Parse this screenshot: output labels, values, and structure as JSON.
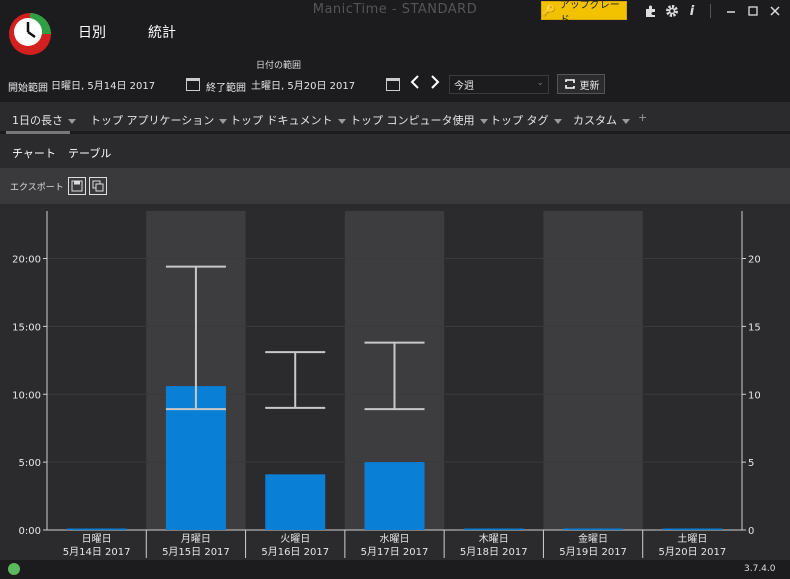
{
  "window": {
    "title": "ManicTime - STANDARD",
    "upgrade_label": "アップグレード"
  },
  "nav": {
    "tabs": [
      {
        "label": "日別"
      },
      {
        "label": "統計"
      }
    ]
  },
  "date_range": {
    "caption": "日付の範囲",
    "start_label": "開始範囲",
    "start_value": "日曜日, 5月14日 2017",
    "end_label": "終了範囲",
    "end_value": "土曜日, 5月20日 2017",
    "period_value": "今週",
    "refresh_label": "更新"
  },
  "report_tabs": [
    {
      "label": "1日の長さ"
    },
    {
      "label": "トップ アプリケーション"
    },
    {
      "label": "トップ ドキュメント"
    },
    {
      "label": "トップ コンピュータ使用"
    },
    {
      "label": "トップ タグ"
    },
    {
      "label": "カスタム"
    }
  ],
  "add_tab_label": "+",
  "view_tabs": [
    {
      "label": "チャート"
    },
    {
      "label": "テーブル"
    }
  ],
  "export": {
    "label": "エクスポート"
  },
  "status": {
    "version": "3.7.4.0"
  },
  "colors": {
    "bar": "#0a7fd6",
    "band": "#3d3d40",
    "bg": "#2b2b2d",
    "error_bar": "#c8c8c8",
    "status_ok": "#5cb85c"
  },
  "chart_data": {
    "type": "bar",
    "categories": [
      {
        "day": "日曜日",
        "date": "5月14日 2017"
      },
      {
        "day": "月曜日",
        "date": "5月15日 2017"
      },
      {
        "day": "火曜日",
        "date": "5月16日 2017"
      },
      {
        "day": "水曜日",
        "date": "5月17日 2017"
      },
      {
        "day": "木曜日",
        "date": "5月18日 2017"
      },
      {
        "day": "金曜日",
        "date": "5月19日 2017"
      },
      {
        "day": "土曜日",
        "date": "5月20日 2017"
      }
    ],
    "values_hours": [
      0,
      10.6,
      4.1,
      5.0,
      0,
      0,
      0
    ],
    "error_bars_hours": [
      null,
      [
        8.9,
        19.4
      ],
      [
        9.0,
        13.1
      ],
      [
        8.9,
        13.8
      ],
      null,
      null,
      null
    ],
    "ylim": [
      0,
      23.5
    ],
    "left_ticks": [
      "0:00",
      "5:00",
      "10:00",
      "15:00",
      "20:00"
    ],
    "right_ticks": [
      "0",
      "5",
      "10",
      "15",
      "20"
    ],
    "tick_values": [
      0,
      5,
      10,
      15,
      20
    ],
    "shaded_columns": [
      1,
      3,
      5
    ],
    "grid": true
  }
}
